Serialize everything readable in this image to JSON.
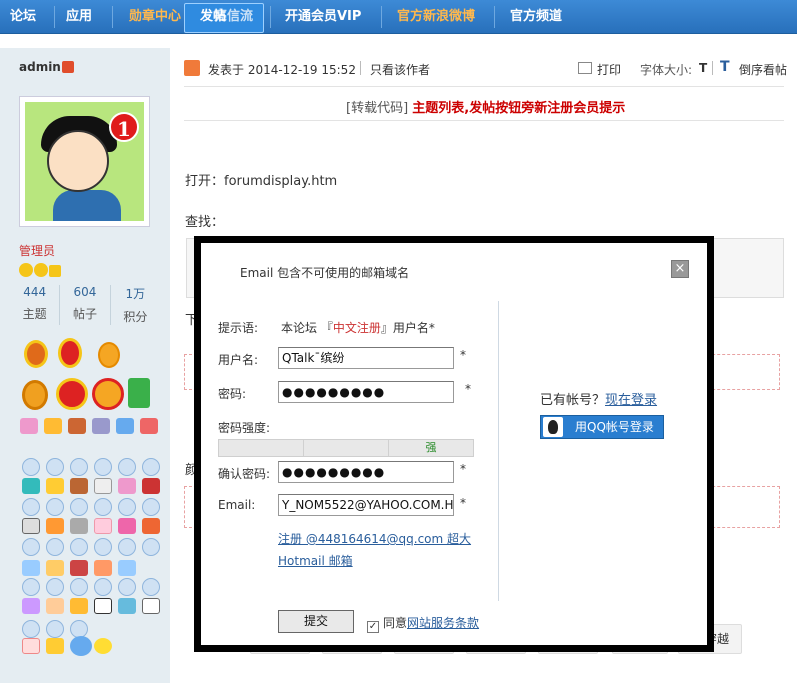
{
  "nav": {
    "items": [
      "论坛",
      "应用",
      "勋章中心",
      "发帖",
      "亮信流",
      "开通会员VIP",
      "官方新浪微博",
      "官方频道"
    ],
    "orange_color": "#ffb84d"
  },
  "user": {
    "name": "admin",
    "role": "管理员",
    "avatar_badge": "1",
    "stats": [
      {
        "value": "444",
        "label": "主题"
      },
      {
        "value": "604",
        "label": "帖子"
      },
      {
        "value": "1万",
        "label": "积分"
      }
    ]
  },
  "post": {
    "posted": "发表于 2014-12-19 15:52",
    "only_author": "只看该作者",
    "print": "打印",
    "font_size": "字体大小:",
    "font_t": "T",
    "reverse": "倒序看帖",
    "title_tag": "[转载代码]",
    "title": "主题列表,发帖按钮旁新注册会员提示",
    "line1": "打开：forumdisplay.htm",
    "line2": "查找：",
    "frag_below": "下",
    "frag_color": "颜",
    "cross": "穿越"
  },
  "modal": {
    "title": "Email 包含不可使用的邮箱域名",
    "close_icon": "×",
    "tip_label": "提示语:",
    "tip_prefix": "本论坛 『",
    "tip_link": "中文注册",
    "tip_suffix": "』用户名*",
    "username_label": "用户名:",
    "username_value": "QTalk¯缤纷",
    "password_label": "密码:",
    "password_value": "●●●●●●●●●",
    "strength_label": "密码强度:",
    "strength_levels": [
      "",
      "",
      "强"
    ],
    "confirm_label": "确认密码:",
    "confirm_value": "●●●●●●●●●",
    "email_label": "Email:",
    "email_value": "Y_NOM5522@YAHOO.COM.HK",
    "required": "*",
    "register_link": "注册 @448164614@qq.com 超大 Hotmail 邮箱",
    "submit_label": "提交",
    "agree_text": "同意",
    "agree_link": "网站服务条款",
    "has_account": "已有帐号？",
    "login_link": "现在登录",
    "qq_login": "用QQ帐号登录"
  }
}
